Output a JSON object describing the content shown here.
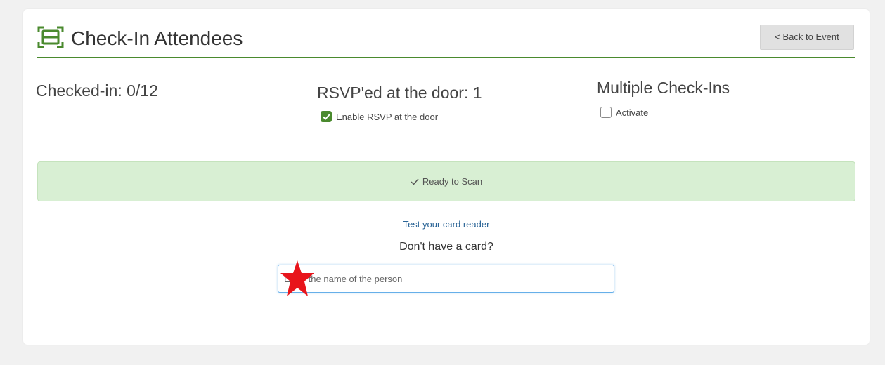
{
  "header": {
    "title": "Check-In Attendees",
    "back_label": "< Back to Event",
    "icon": "barcode-scanner-icon"
  },
  "stats": {
    "checked_in": "Checked-in: 0/12",
    "rsvp_at_door": "RSVP'ed at the door: 1",
    "multiple_checkins": "Multiple Check-Ins"
  },
  "options": {
    "enable_rsvp_label": "Enable RSVP at the door",
    "enable_rsvp_checked": true,
    "activate_label": "Activate",
    "activate_checked": false
  },
  "scan_status": {
    "text": "Ready to Scan",
    "icon": "checkmark-icon"
  },
  "card_reader": {
    "test_link": "Test your card reader",
    "no_card_text": "Don't have a card?",
    "name_placeholder": "Enter the name of the person"
  },
  "annotation": {
    "marker": "red-star-icon",
    "color": "#e8141b"
  },
  "colors": {
    "brand_green": "#4a8a2e",
    "ready_bg": "#d8efd3",
    "link_blue": "#2a6496"
  }
}
